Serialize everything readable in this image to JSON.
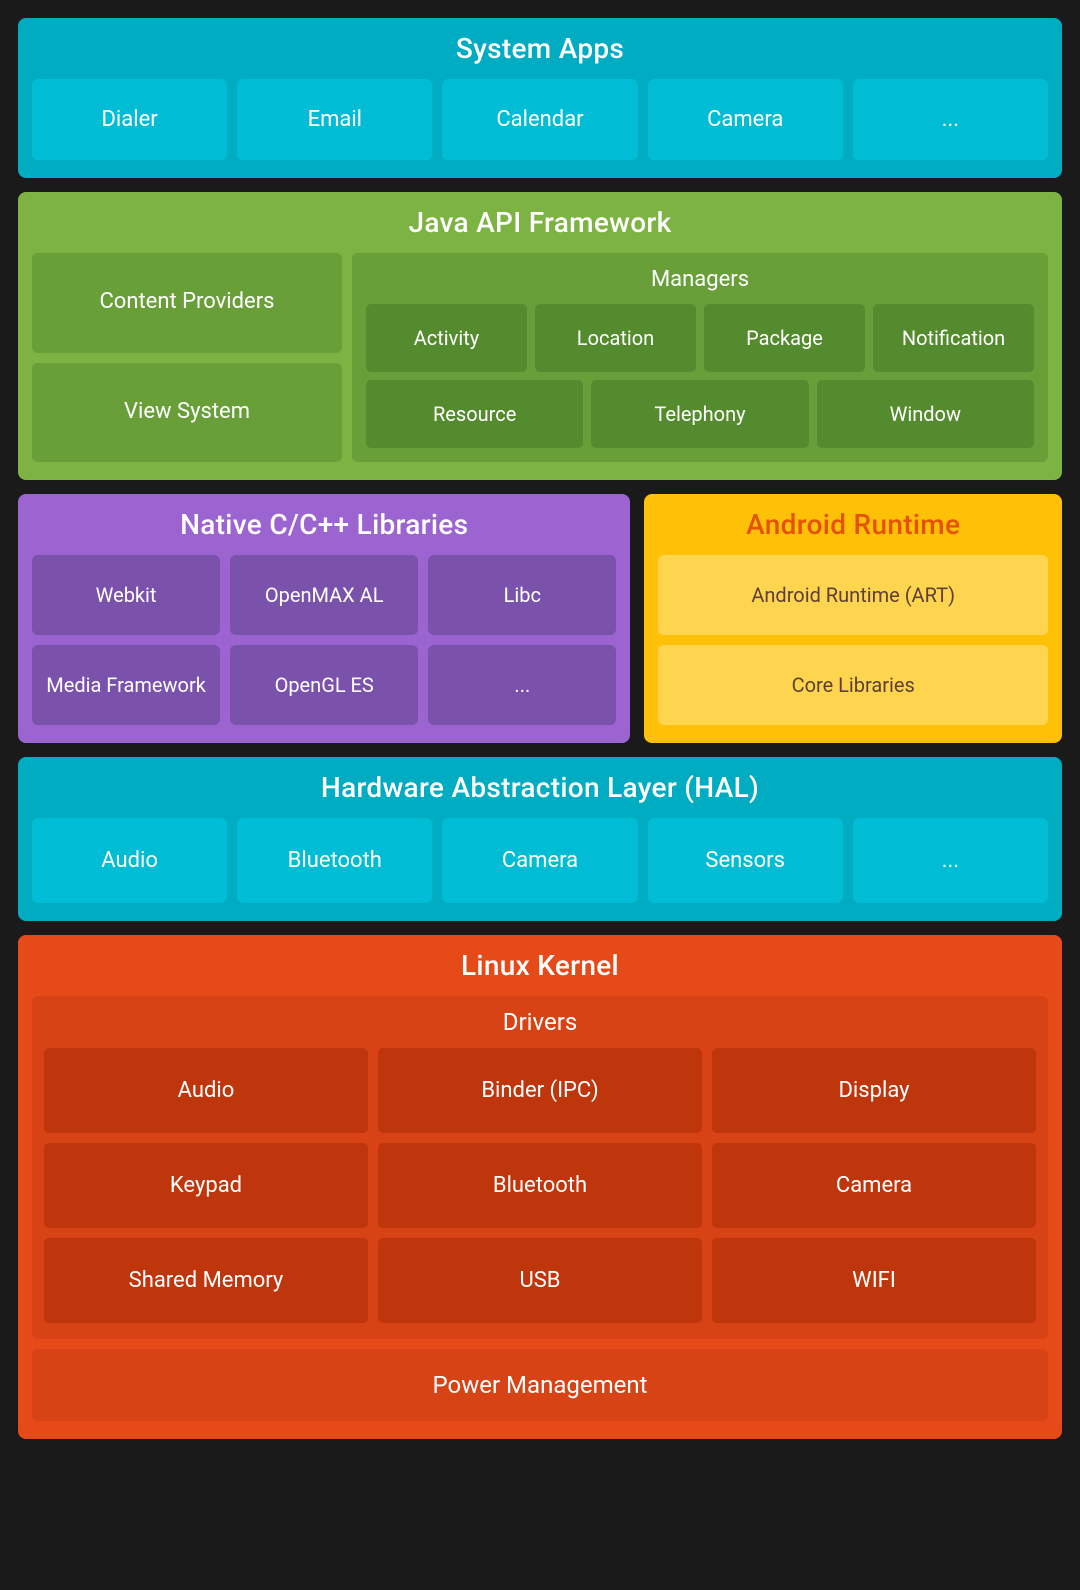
{
  "system_apps": {
    "title": "System Apps",
    "apps": [
      "Dialer",
      "Email",
      "Calendar",
      "Camera",
      "..."
    ]
  },
  "java_api": {
    "title": "Java API Framework",
    "left": {
      "items": [
        "Content Providers",
        "View System"
      ]
    },
    "right": {
      "title": "Managers",
      "row1": [
        "Activity",
        "Location",
        "Package",
        "Notification"
      ],
      "row2": [
        "Resource",
        "Telephony",
        "Window"
      ]
    }
  },
  "native_cpp": {
    "title": "Native C/C++ Libraries",
    "items": [
      "Webkit",
      "OpenMAX AL",
      "Libc",
      "Media Framework",
      "OpenGL ES",
      "..."
    ]
  },
  "android_runtime": {
    "title": "Android Runtime",
    "items": [
      "Android Runtime (ART)",
      "Core Libraries"
    ]
  },
  "hal": {
    "title": "Hardware Abstraction Layer (HAL)",
    "items": [
      "Audio",
      "Bluetooth",
      "Camera",
      "Sensors",
      "..."
    ]
  },
  "linux_kernel": {
    "title": "Linux Kernel",
    "drivers": {
      "title": "Drivers",
      "items": [
        "Audio",
        "Binder (IPC)",
        "Display",
        "Keypad",
        "Bluetooth",
        "Camera",
        "Shared Memory",
        "USB",
        "WIFI"
      ]
    },
    "power_management": "Power Management"
  }
}
